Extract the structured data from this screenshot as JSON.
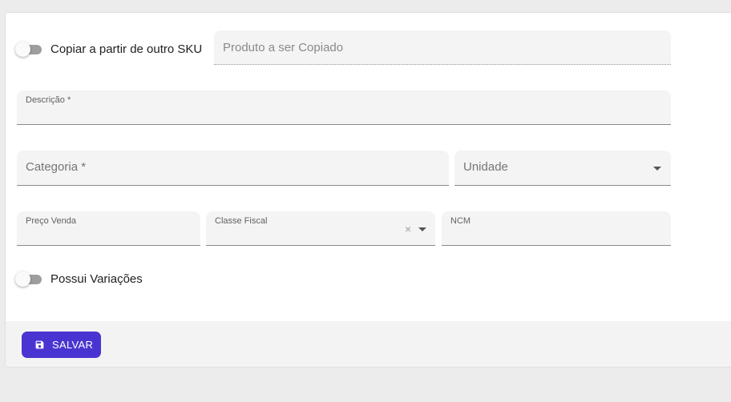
{
  "form": {
    "copy_toggle": {
      "label": "Copiar a partir de outro SKU",
      "checked": false
    },
    "copy_product_field": {
      "placeholder": "Produto a ser Copiado"
    },
    "descricao_field": {
      "label": "Descrição *",
      "value": ""
    },
    "categoria_field": {
      "label": "Categoria *",
      "value": ""
    },
    "unidade_field": {
      "label": "Unidade",
      "value": ""
    },
    "preco_venda_field": {
      "label": "Preço Venda",
      "value": ""
    },
    "classe_fiscal_field": {
      "label": "Classe Fiscal",
      "value": "",
      "clear_glyph": "×"
    },
    "ncm_field": {
      "label": "NCM",
      "value": ""
    },
    "variations_toggle": {
      "label": "Possui Variações",
      "checked": false
    }
  },
  "footer": {
    "save_button": {
      "label": "SALVAR",
      "icon": "floppy-disk-icon"
    }
  },
  "colors": {
    "accent": "#4a34d1",
    "field_bg": "#f4f4f4",
    "page_bg": "#ececec"
  }
}
